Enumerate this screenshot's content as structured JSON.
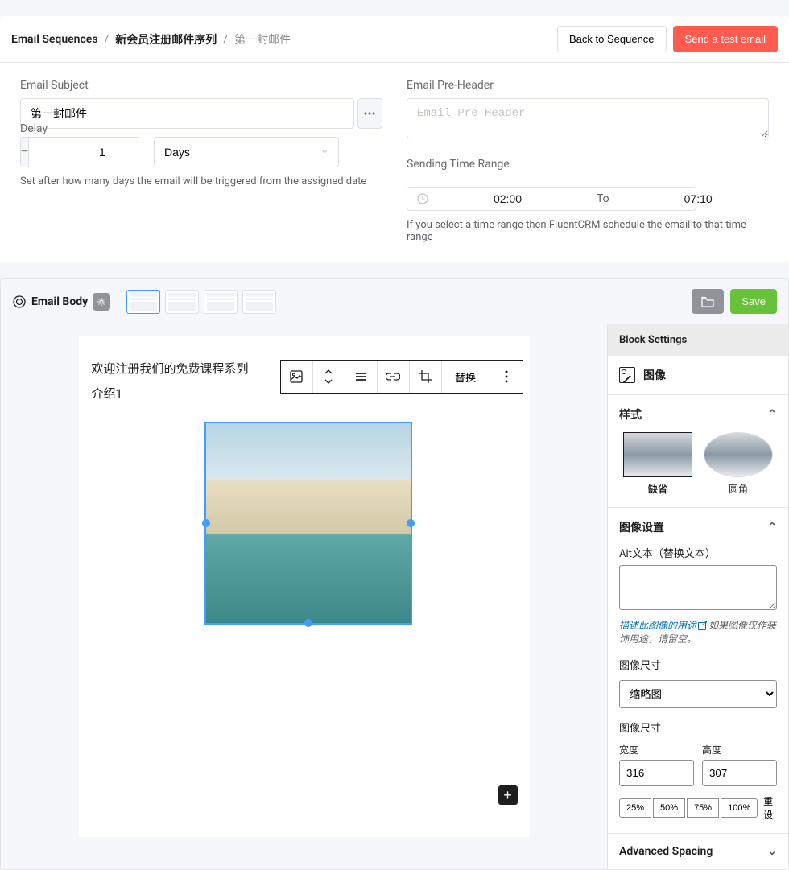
{
  "breadcrumb": {
    "root": "Email Sequences",
    "parent": "新会员注册邮件序列",
    "current": "第一封邮件"
  },
  "actions": {
    "back": "Back to Sequence",
    "send_test": "Send a test email"
  },
  "form": {
    "subject_label": "Email Subject",
    "subject_value": "第一封邮件",
    "preheader_label": "Email Pre-Header",
    "preheader_placeholder": "Email Pre-Header",
    "delay_label": "Delay",
    "delay_value": "1",
    "delay_unit": "Days",
    "delay_helper": "Set after how many days the email will be triggered from the assigned date",
    "time_label": "Sending Time Range",
    "time_from": "02:00",
    "time_to": "07:10",
    "time_sep": "To",
    "time_helper": "If you select a time range then FluentCRM schedule the email to that time range"
  },
  "body": {
    "title": "Email Body",
    "save": "Save",
    "content_line1": "欢迎注册我们的免费课程系列",
    "content_line2": "介绍1",
    "replace_btn": "替换"
  },
  "sidebar": {
    "header": "Block Settings",
    "block_title": "图像",
    "style_section": "样式",
    "style_default": "缺省",
    "style_rounded": "圆角",
    "img_settings_section": "图像设置",
    "alt_label": "Alt文本（替换文本）",
    "alt_help_link": "描述此图像的用途",
    "alt_help_text": " 如果图像仅作装饰用途，请留空。",
    "size_label": "图像尺寸",
    "size_value": "缩略图",
    "dimensions_label": "图像尺寸",
    "width_label": "宽度",
    "width_value": "316",
    "height_label": "高度",
    "height_value": "307",
    "pct_25": "25%",
    "pct_50": "50%",
    "pct_75": "75%",
    "pct_100": "100%",
    "reset": "重设",
    "advanced_section": "Advanced Spacing"
  }
}
